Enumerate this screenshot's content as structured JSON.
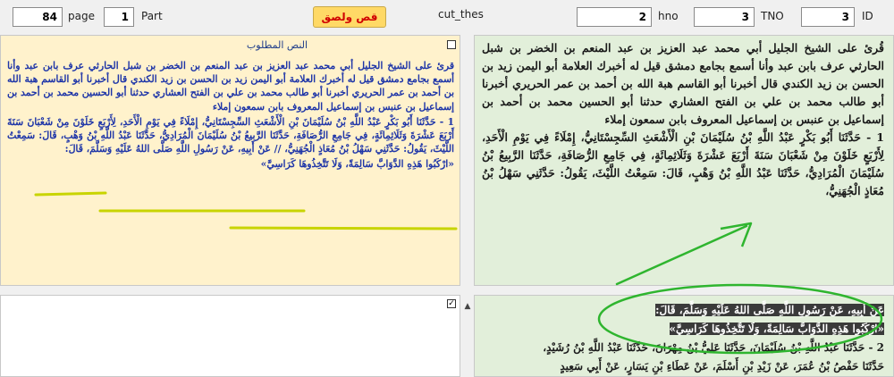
{
  "toolbar": {
    "page_value": "84",
    "page_label": "page",
    "part_value": "1",
    "part_label": "Part",
    "paste_button": "قص ولصق",
    "cut_label": "cut_thes",
    "hno_value": "2",
    "hno_label": "hno",
    "tno_value": "3",
    "tno_label": "TNO",
    "id_value": "3",
    "id_label": "ID"
  },
  "left_panel": {
    "title": "النص المطلوب",
    "intro": "قرئ على الشيخ الجليل أبي محمد عبد العزيز بن عبد المنعم بن الخضر بن شبل الحارثي عرف بابن عبد وأنا أسمع بجامع دمشق قيل له أخبرك العلامة أبو اليمن زيد بن الحسن بن زيد الكندي قال أخبرنا أبو القاسم هبة الله بن أحمد بن عمر الحريري أخبرنا أبو طالب محمد بن علي بن الفتح العشاري حدثنا أبو الحسين محمد بن أحمد بن إسماعيل بن عنبس بن إسماعيل المعروف بابن سمعون إملاء",
    "hadith": "1 - حَدَّثَنَا أَبُو بَكْرٍ عَبْدُ اللَّهِ بْنُ سُلَيْمَانَ بْنِ الْأَشْعَثِ السِّجِسْتَانِيُّ، إِمْلَاءً فِي يَوْمِ الْأَحَدِ، لِأَرْبَعٍ خَلَوْنَ مِنْ شَعْبَانَ سَنَةَ أَرْبَعَ عَشْرَةَ وَثَلَاثِمِائَةٍ، فِي جَامِعِ الرُّصَافَةِ، حَدَّثَنَا الرَّبِيعُ بْنُ سُلَيْمَانَ الْمُرَادِيُّ، حَدَّثَنَا عَبْدُ اللَّهِ بْنُ وَهْبٍ، قَالَ: سَمِعْتُ اللَّيْثَ، يَقُولُ: حَدَّثَنِي سَهْلُ بْنُ مُعَاذٍ الْجُهَنِيُّ، // عَنْ أَبِيهِ، عَنْ رَسُولِ اللَّهِ صَلَّى اللهُ عَلَيْهِ وَسَلَّمَ، قَالَ:",
    "quote": "«ارْكَبُوا هَذِهِ الدَّوَابَّ سَالِمَةً، وَلَا تَتَّخِذُوهَا كَرَاسِيَّ»"
  },
  "right_panel": {
    "intro": "قُرئ على الشيخ الجليل أبي محمد عبد العزيز بن عبد المنعم بن الخضر بن شبل الحارثي عرف بابن عبد وأنا أسمع بجامع دمشق قيل له أخبرك العلامة أبو اليمن زيد بن الحسن بن زيد الكندي قال أخبرنا أبو القاسم هبة الله بن أحمد بن عمر الحريري أخبرنا أبو طالب محمد بن علي بن الفتح العشاري حدثنا أبو الحسين محمد بن أحمد بن إسماعيل بن عنبس بن إسماعيل المعروف بابن سمعون إملاء",
    "hadith": "1 - حَدَّثَنَا أَبُو بَكْرٍ عَبْدُ اللَّهِ بْنُ سُلَيْمَانَ بْنِ الْأَشْعَثِ السِّجِسْتَانِيُّ، إِمْلَاءً فِي يَوْمِ الْأَحَدِ، لِأَرْبَعٍ خَلَوْنَ مِنْ شَعْبَانَ سَنَةَ أَرْبَعَ عَشْرَةَ وَثَلَاثِمِائَةٍ، فِي جَامِعِ الرُّصَافَةِ، حَدَّثَنَا الرَّبِيعُ بْنُ سُلَيْمَانَ الْمُرَادِيُّ، حَدَّثَنَا عَبْدُ اللَّهِ بْنُ وَهْبٍ، قَالَ: سَمِعْتُ اللَّيْثَ، يَقُولُ: حَدَّثَنِي سَهْلُ بْنُ مُعَاذٍ الْجُهَنِيُّ،"
  },
  "bottom_right": {
    "line1": "عَنْ أَبِيهِ، عَنْ رَسُولِ اللَّهِ صَلَّى اللهُ عَلَيْهِ وَسَلَّمَ، قَالَ:",
    "line2": "«ارْكَبُوا هَذِهِ الدَّوَابَّ سَالِمَةً، وَلَا تَتَّخِذُوهَا كَرَاسِيَّ»",
    "line3": "2 - حَدَّثَنَا عَبْدُ اللَّهِ بْنُ سُلَيْمَانَ، حَدَّثَنَا عَلِيُّ بْنُ مِهْرَانَ، حَدَّثَنَا عَبْدُ اللَّهِ بْنُ رُشَيْدٍ،",
    "line4": "حَدَّثَنَا حَفْصُ بْنُ عُمَرَ، عَنْ زَيْدِ بْنِ أَسْلَمَ، عَنْ عَطَاءِ بْنِ يَسَارٍ، عَنْ أَبِي سَعِيدٍ"
  },
  "colors": {
    "left_bg": "#fff2cc",
    "right_bg": "#e2efda",
    "annotation_green": "#2fb52f",
    "underline_yellow": "#c8d400"
  }
}
